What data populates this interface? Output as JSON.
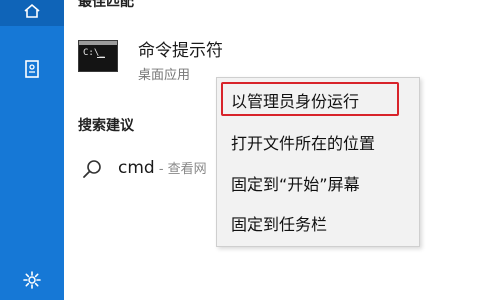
{
  "rail": {
    "items": [
      {
        "name": "home-icon"
      },
      {
        "name": "documents-icon"
      },
      {
        "name": "gear-icon"
      }
    ],
    "colors": {
      "rail": "#1678d6",
      "active": "#0f64b8"
    }
  },
  "best_match": {
    "title": "最佳匹配",
    "app_name": "命令提示符",
    "app_type": "桌面应用"
  },
  "suggestions": {
    "title": "搜索建议",
    "query": "cmd",
    "hint": " - 查看网"
  },
  "context_menu": {
    "items": [
      "以管理员身份运行",
      "打开文件所在的位置",
      "固定到“开始”屏幕",
      "固定到任务栏"
    ],
    "highlight_color": "#d8232a"
  }
}
